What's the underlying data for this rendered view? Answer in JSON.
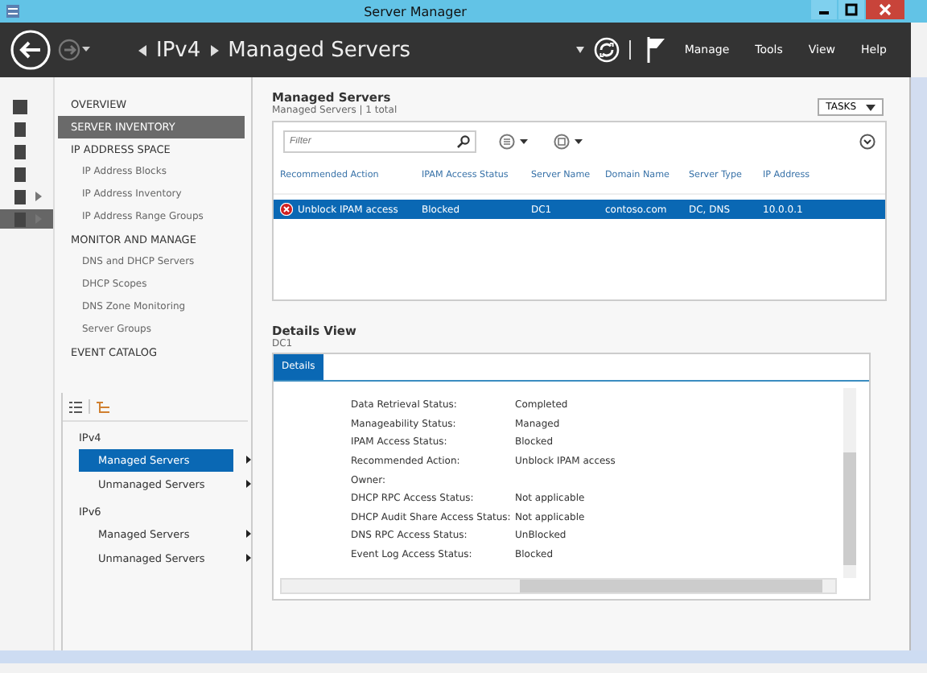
{
  "window": {
    "title": "Server Manager"
  },
  "navbar": {
    "breadcrumb": [
      "IPv4",
      "Managed Servers"
    ],
    "menu": [
      "Manage",
      "Tools",
      "View",
      "Help"
    ]
  },
  "icon_strip": [
    {
      "selected": false,
      "arrow": false
    },
    {
      "selected": false,
      "arrow": false
    },
    {
      "selected": false,
      "arrow": false
    },
    {
      "selected": false,
      "arrow": false
    },
    {
      "selected": false,
      "arrow": true
    },
    {
      "selected": true,
      "arrow": true
    }
  ],
  "sidebar": {
    "items": [
      {
        "label": "OVERVIEW",
        "kind": "section",
        "selected": false
      },
      {
        "label": "SERVER INVENTORY",
        "kind": "section",
        "selected": true
      },
      {
        "label": "IP ADDRESS SPACE",
        "kind": "section",
        "selected": false
      },
      {
        "label": "IP Address Blocks",
        "kind": "sub",
        "selected": false
      },
      {
        "label": "IP Address Inventory",
        "kind": "sub",
        "selected": false
      },
      {
        "label": "IP Address Range Groups",
        "kind": "sub",
        "selected": false
      },
      {
        "label": "MONITOR AND MANAGE",
        "kind": "section",
        "selected": false
      },
      {
        "label": "DNS and DHCP Servers",
        "kind": "sub",
        "selected": false
      },
      {
        "label": "DHCP Scopes",
        "kind": "sub",
        "selected": false
      },
      {
        "label": "DNS Zone Monitoring",
        "kind": "sub",
        "selected": false
      },
      {
        "label": "Server Groups",
        "kind": "sub",
        "selected": false
      },
      {
        "label": "EVENT CATALOG",
        "kind": "section",
        "selected": false
      }
    ]
  },
  "tree": {
    "groups": [
      {
        "label": "IPv4",
        "children": [
          {
            "label": "Managed Servers",
            "selected": true
          },
          {
            "label": "Unmanaged Servers",
            "selected": false
          }
        ]
      },
      {
        "label": "IPv6",
        "children": [
          {
            "label": "Managed Servers",
            "selected": false
          },
          {
            "label": "Unmanaged Servers",
            "selected": false
          }
        ]
      }
    ]
  },
  "managed_servers": {
    "title": "Managed Servers",
    "subtitle": "Managed Servers | 1 total",
    "tasks": "TASKS",
    "filter": {
      "placeholder": "Filter"
    },
    "table": {
      "columns": [
        "Recommended Action",
        "IPAM Access Status",
        "Server Name",
        "Domain Name",
        "Server Type",
        "IP Address"
      ],
      "rows": [
        {
          "selected": true,
          "error": true,
          "cells": [
            "Unblock IPAM access",
            "Blocked",
            "DC1",
            "contoso.com",
            "DC, DNS",
            "10.0.0.1"
          ]
        }
      ]
    }
  },
  "details": {
    "title": "Details View",
    "subtitle": "DC1",
    "tab": {
      "label": "Details",
      "selected": true
    },
    "fields": [
      {
        "label": "Data Retrieval Status:",
        "value": "Completed"
      },
      {
        "label": "Manageability Status:",
        "value": "Managed"
      },
      {
        "label": "IPAM Access Status:",
        "value": "Blocked"
      },
      {
        "label": "Recommended Action:",
        "value": "Unblock IPAM access"
      },
      {
        "label": "Owner:"
      },
      {
        "label": "DHCP RPC Access Status:",
        "value": "Not applicable"
      },
      {
        "label": "DHCP Audit Share Access Status:",
        "value": "Not applicable"
      },
      {
        "label": "DNS RPC Access Status:",
        "value": "UnBlocked"
      },
      {
        "label": "Event Log Access Status:",
        "value": "Blocked"
      }
    ]
  }
}
